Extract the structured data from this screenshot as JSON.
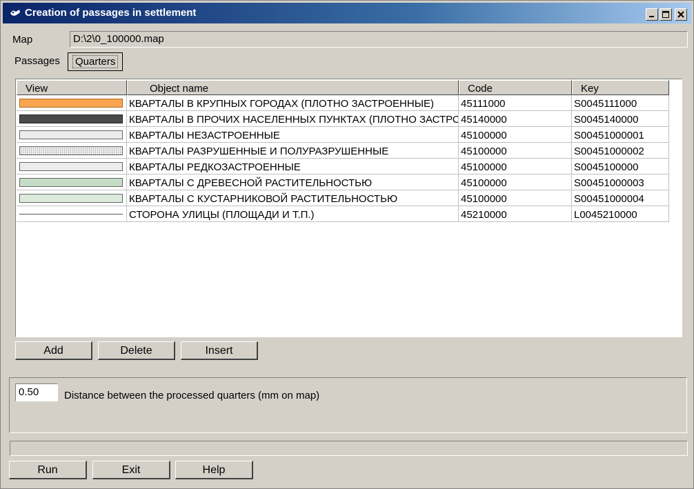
{
  "window": {
    "title": "Creation of passages in settlement",
    "controls": [
      "minimize",
      "maximize",
      "close"
    ]
  },
  "map": {
    "label": "Map",
    "value": "D:\\2\\0_100000.map"
  },
  "tabs": [
    {
      "label": "Passages",
      "active": false
    },
    {
      "label": "Quarters",
      "active": true
    }
  ],
  "grid": {
    "columns": [
      "View",
      "Object name",
      "Code",
      "Key"
    ],
    "rows": [
      {
        "name": "КВАРТАЛЫ В КРУПНЫХ ГОРОДАХ (ПЛОТНО ЗАСТРОЕННЫЕ)",
        "code": "45111000",
        "key": "S0045111000",
        "swatch": "orange"
      },
      {
        "name": "КВАРТАЛЫ В ПРОЧИХ НАСЕЛЕННЫХ ПУНКТАХ (ПЛОТНО ЗАСТРОЕННЫЕ)",
        "code": "45140000",
        "key": "S0045140000",
        "swatch": "dark"
      },
      {
        "name": "КВАРТАЛЫ НЕЗАСТРОЕННЫЕ",
        "code": "45100000",
        "key": "S00451000001",
        "swatch": "light"
      },
      {
        "name": "КВАРТАЛЫ РАЗРУШЕННЫЕ И ПОЛУРАЗРУШЕННЫЕ",
        "code": "45100000",
        "key": "S00451000002",
        "swatch": "dotted"
      },
      {
        "name": "КВАРТАЛЫ РЕДКОЗАСТРОЕННЫЕ",
        "code": "45100000",
        "key": "S0045100000",
        "swatch": "light"
      },
      {
        "name": "КВАРТАЛЫ С ДРЕВЕСНОЙ РАСТИТЕЛЬНОСТЬЮ",
        "code": "45100000",
        "key": "S00451000003",
        "swatch": "green"
      },
      {
        "name": "КВАРТАЛЫ С КУСТАРНИКОВОЙ РАСТИТЕЛЬНОСТЬЮ",
        "code": "45100000",
        "key": "S00451000004",
        "swatch": "palegreen"
      },
      {
        "name": "СТОРОНА УЛИЦЫ (ПЛОЩАДИ И Т.П.)",
        "code": "45210000",
        "key": "L0045210000",
        "swatch": "line"
      }
    ]
  },
  "list_buttons": {
    "add": "Add",
    "delete": "Delete",
    "insert": "Insert"
  },
  "distance": {
    "value": "0.50",
    "label": "Distance between the processed quarters (mm on map)"
  },
  "footer_buttons": {
    "run": "Run",
    "exit": "Exit",
    "help": "Help"
  },
  "colors": {
    "orange": "#f9a54f",
    "dark": "#4a4a4a",
    "light": "#ececec",
    "green": "#c5dcc5",
    "palegreen": "#dcebdc",
    "titlebar": "#0a246a"
  }
}
